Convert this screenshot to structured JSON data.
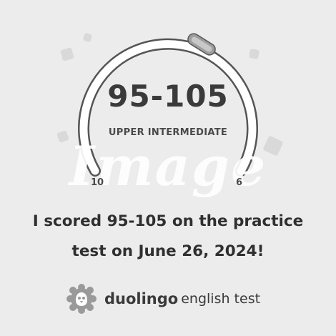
{
  "score": {
    "range": "95-105",
    "level": "UPPER INTERMEDIATE",
    "scale_min_label": "10",
    "scale_max_label": "6",
    "fill_fraction": 0.63
  },
  "watermark": "Image",
  "message": {
    "line1": "I scored 95-105 on the practice",
    "line2": "test on June 26, 2024!"
  },
  "brand": {
    "name": "duolingo",
    "product": "english test",
    "icon": "duolingo-owl-icon"
  },
  "colors": {
    "background": "#ececec",
    "gauge_track": "#ffffff",
    "gauge_outline": "#555555",
    "marker": "#bdbdbd",
    "text": "#333333"
  }
}
